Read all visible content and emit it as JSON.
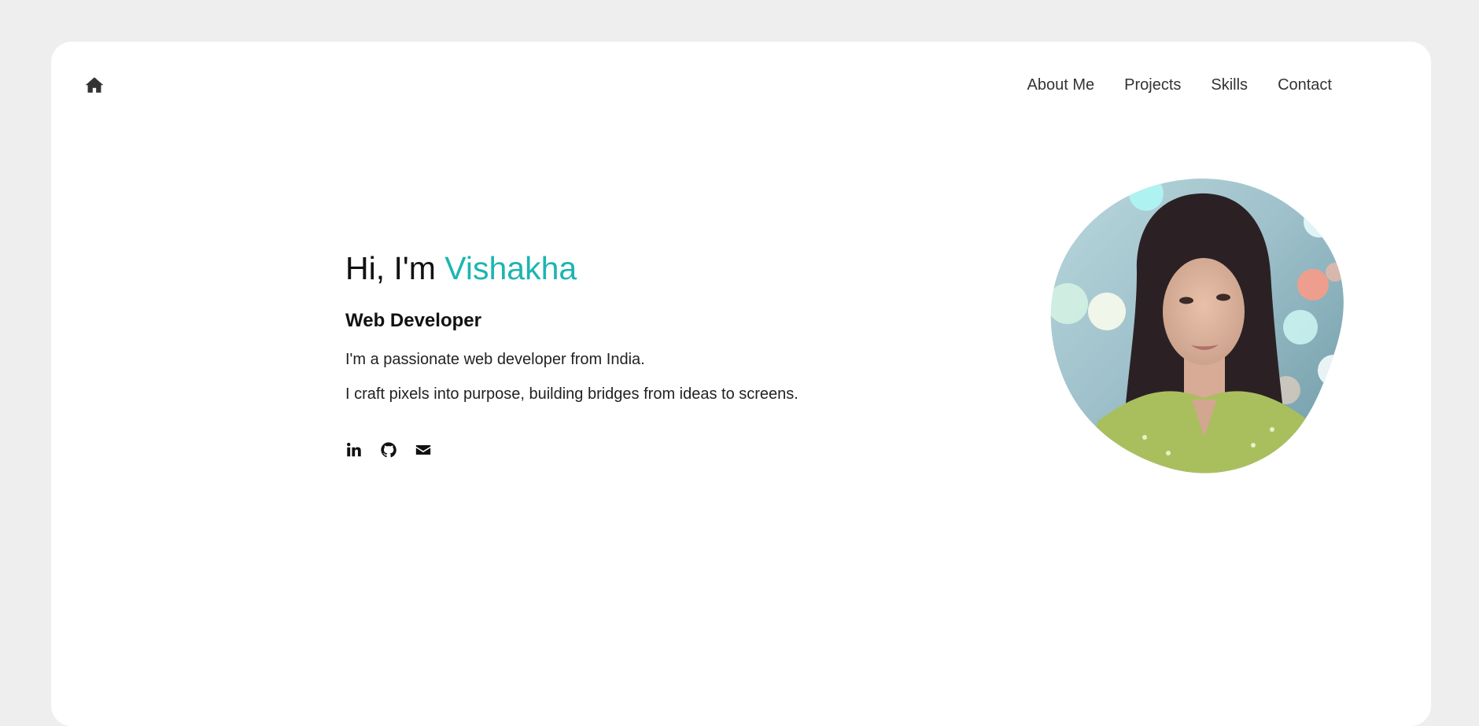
{
  "colors": {
    "accent": "#1cb5b2",
    "page_background": "#eeeeee",
    "card_background": "#ffffff",
    "nav_text": "#333333"
  },
  "header": {
    "home_icon": "home-icon",
    "nav": [
      "About Me",
      "Projects",
      "Skills",
      "Contact"
    ]
  },
  "hero": {
    "greeting_prefix": "Hi, I'm ",
    "name": "Vishakha",
    "role": "Web Developer",
    "lines": [
      "I'm a passionate web developer from India.",
      "I craft pixels into purpose, building bridges from ideas to screens."
    ],
    "socials": [
      "linkedin-icon",
      "github-icon",
      "email-icon"
    ]
  },
  "profile_photo": {
    "description": "profile-photo"
  }
}
